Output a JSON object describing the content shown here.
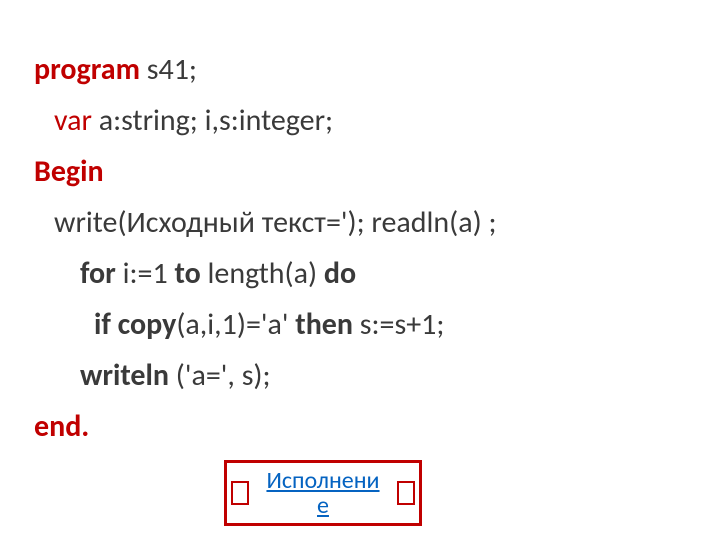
{
  "code": {
    "l1_program": "program",
    "l1_rest": " s41;",
    "l2_var": "var",
    "l2_rest": " a:string; i,s:integer;",
    "l3_begin": "Begin",
    "l4_a": "write(",
    "l4_b": "Исходный текст",
    "l4_c": "='); readln(a) ;",
    "l5_a": "for",
    "l5_b": " i:=1 ",
    "l5_c": "to",
    "l5_d": " length(a) ",
    "l5_e": "do",
    "l6_a": "if copy",
    "l6_b": "(a,i,1)='а' ",
    "l6_c": "then",
    "l6_d": " s:=s+1;",
    "l7_a": "writeln",
    "l7_b": " ('а=', s);",
    "l8_end": "end."
  },
  "button": {
    "label": "Исполнение"
  }
}
